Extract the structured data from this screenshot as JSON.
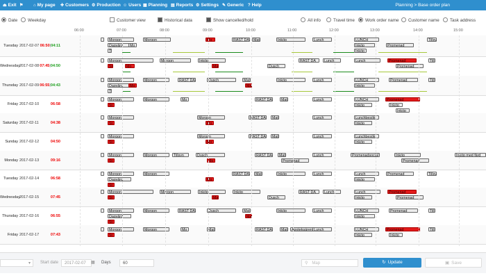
{
  "menu": [
    {
      "label": "Exit",
      "icon": "exit-icon",
      "glyph": "⏏"
    },
    {
      "label": "",
      "icon": "flag-icon",
      "glyph": "⚑"
    },
    {
      "label": "My page",
      "icon": "home-icon",
      "glyph": "⌂"
    },
    {
      "label": "Customers",
      "icon": "customers-icon",
      "glyph": "✚"
    },
    {
      "label": "Production",
      "icon": "production-icon",
      "glyph": "⚙"
    },
    {
      "label": "Users",
      "icon": "users-icon",
      "glyph": "☺"
    },
    {
      "label": "Planning",
      "icon": "planning-icon",
      "glyph": "▦"
    },
    {
      "label": "Reports",
      "icon": "reports-icon",
      "glyph": "▤"
    },
    {
      "label": "Settings",
      "icon": "settings-icon",
      "glyph": "⚙"
    },
    {
      "label": "Generic",
      "icon": "generic-icon",
      "glyph": "✎"
    },
    {
      "label": "Help",
      "icon": "help-icon",
      "glyph": "?"
    }
  ],
  "breadcrumb": "Planning > Base order plan",
  "options": {
    "date": "Date",
    "weekday": "Weekday",
    "customer_view": "Customer view",
    "historical": "Historical data",
    "show_cancelled": "Show cancelled/hold",
    "all_info": "All info",
    "travel_time": "Travel time",
    "work_order_name": "Work order name",
    "customer_name": "Customer name",
    "task_address": "Task address"
  },
  "time_ticks": [
    "06:00",
    "07:00",
    "08:00",
    "09:00",
    "10:00",
    "11:00",
    "12:00",
    "13:00",
    "14:00",
    "15:00"
  ],
  "rows": [
    {
      "day": "Tuesday",
      "date": "2017-02-07",
      "t1": "06:50",
      "t2": "04:11",
      "events": [
        [
          "Morgon",
          155,
          38,
          0
        ],
        [
          "Dagvård",
          155,
          34,
          1
        ],
        [
          "Mo",
          185,
          12,
          1
        ],
        [
          "T",
          155,
          6,
          2
        ],
        [
          "Morgon",
          206,
          40,
          0
        ],
        [
          "Mo",
          296,
          14,
          0,
          true
        ],
        [
          "RAST DA",
          334,
          26,
          0
        ],
        [
          "Mat",
          363,
          12,
          0
        ],
        [
          "Inköp",
          398,
          42,
          0
        ],
        [
          "Lunch",
          450,
          28,
          0
        ],
        [
          "LUNCH",
          510,
          36,
          0
        ],
        [
          "Inköp",
          510,
          30,
          1
        ],
        [
          "Inköp",
          510,
          18,
          2
        ],
        [
          "Promenad",
          556,
          40,
          1
        ],
        [
          "Tillsyn",
          615,
          14,
          0
        ]
      ]
    },
    {
      "day": "Wednesday",
      "date": "2017-02-08",
      "t1": "07:45",
      "t2": "04:50",
      "events": [
        [
          "Morgon",
          155,
          66,
          0
        ],
        [
          "Morgon",
          230,
          45,
          0
        ],
        [
          "Inköp",
          285,
          40,
          0
        ],
        [
          "Dusch",
          385,
          26,
          1
        ],
        [
          "RAST DA",
          430,
          30,
          0
        ],
        [
          "Lunch",
          465,
          26,
          0
        ],
        [
          "Mat",
          305,
          10,
          1,
          true
        ],
        [
          "Mo",
          180,
          14,
          1,
          true
        ],
        [
          "St",
          155,
          8,
          1,
          true
        ],
        [
          "Lunch",
          510,
          38,
          0
        ],
        [
          "Promenad",
          558,
          42,
          0,
          true
        ],
        [
          "Promenad",
          570,
          40,
          1
        ],
        [
          "Tills",
          617,
          10,
          0
        ]
      ]
    },
    {
      "day": "Thursday",
      "date": "2017-02-09",
      "t1": "06:55",
      "t2": "04:43",
      "events": [
        [
          "Morgon",
          155,
          38,
          0
        ],
        [
          "Dagvård",
          155,
          34,
          1
        ],
        [
          "Mo",
          185,
          12,
          1,
          true
        ],
        [
          "T",
          155,
          6,
          2
        ],
        [
          "Morgon",
          206,
          38,
          0
        ],
        [
          "RAST DA",
          256,
          26,
          0
        ],
        [
          "Dusch",
          298,
          42,
          0
        ],
        [
          "Mat",
          349,
          12,
          0
        ],
        [
          "Mat",
          353,
          10,
          1,
          true
        ],
        [
          "Inköp",
          398,
          42,
          0
        ],
        [
          "Lunch",
          450,
          28,
          0
        ],
        [
          "LUNCH",
          510,
          36,
          0
        ],
        [
          "Inköp",
          510,
          30,
          1
        ],
        [
          "Promenad",
          560,
          42,
          0
        ],
        [
          "Tills",
          617,
          10,
          0
        ]
      ]
    },
    {
      "day": "Friday",
      "date": "2017-02-10",
      "t1": "06:58",
      "t2": "",
      "events": [
        [
          "Morgon",
          155,
          38,
          0
        ],
        [
          "St",
          155,
          10,
          1,
          true
        ],
        [
          "Morgon",
          206,
          38,
          0
        ],
        [
          "Mo",
          260,
          12,
          0
        ],
        [
          "RAST DA",
          367,
          26,
          0
        ],
        [
          "Mat",
          403,
          12,
          0
        ],
        [
          "Lunch",
          450,
          28,
          0
        ],
        [
          "LUNCH",
          510,
          36,
          0
        ],
        [
          "Inköp",
          510,
          26,
          1
        ],
        [
          "Promenad",
          555,
          50,
          0,
          true
        ],
        [
          "Inköp",
          560,
          20,
          1
        ],
        [
          "Inköp",
          570,
          20,
          2
        ]
      ]
    },
    {
      "day": "Saturday",
      "date": "2017-02-11",
      "t1": "04:38",
      "t2": "",
      "events": [
        [
          "Morgon",
          155,
          38,
          0
        ],
        [
          "St",
          155,
          10,
          1,
          true
        ],
        [
          "Morgon",
          284,
          40,
          0
        ],
        [
          "Mo",
          296,
          12,
          1,
          true
        ],
        [
          "RAST DA",
          358,
          26,
          0
        ],
        [
          "Mat",
          390,
          12,
          0
        ],
        [
          "Lunch",
          450,
          28,
          0
        ],
        [
          "Lunchbesök",
          510,
          36,
          0
        ],
        [
          "Inköp",
          510,
          26,
          1
        ]
      ]
    },
    {
      "day": "Sunday",
      "date": "2017-02-12",
      "t1": "04:50",
      "t2": "",
      "events": [
        [
          "Morgon",
          155,
          38,
          0
        ],
        [
          "St",
          155,
          10,
          1,
          true
        ],
        [
          "Morgon",
          284,
          40,
          0
        ],
        [
          "Mo",
          296,
          12,
          1,
          true
        ],
        [
          "RAST DA",
          358,
          26,
          0
        ],
        [
          "Mat",
          390,
          12,
          0
        ],
        [
          "Lunch",
          450,
          28,
          0
        ],
        [
          "Lunchbesök",
          510,
          36,
          0
        ],
        [
          "Inköp",
          510,
          26,
          1
        ]
      ]
    },
    {
      "day": "Monday",
      "date": "2017-02-13",
      "t1": "09:16",
      "t2": "",
      "events": [
        [
          "Morgon",
          155,
          38,
          0
        ],
        [
          "St",
          155,
          10,
          1,
          true
        ],
        [
          "Morgon",
          206,
          38,
          0
        ],
        [
          "Tillsyn",
          248,
          24,
          0
        ],
        [
          "Dusch",
          282,
          42,
          0
        ],
        [
          "Mo",
          298,
          12,
          1,
          true
        ],
        [
          "RAST DA",
          367,
          26,
          0
        ],
        [
          "Mat",
          400,
          12,
          0
        ],
        [
          "Promenad",
          405,
          40,
          1
        ],
        [
          "Lunch",
          450,
          28,
          0
        ],
        [
          "Promenadsocial",
          505,
          42,
          0
        ],
        [
          "Inköp",
          568,
          38,
          0
        ],
        [
          "Promenad",
          578,
          40,
          1
        ],
        [
          "Inköp med färd",
          655,
          45,
          0
        ]
      ]
    },
    {
      "day": "Tuesday",
      "date": "2017-02-14",
      "t1": "06:58",
      "t2": "",
      "events": [
        [
          "Morgon",
          155,
          38,
          0
        ],
        [
          "Dagvård",
          155,
          34,
          1
        ],
        [
          "St",
          155,
          10,
          2,
          true
        ],
        [
          "Morgon",
          206,
          38,
          0
        ],
        [
          "Mo",
          296,
          12,
          1,
          true
        ],
        [
          "RAST DA",
          334,
          26,
          0
        ],
        [
          "Mat",
          366,
          12,
          0
        ],
        [
          "Inköp",
          398,
          42,
          0
        ],
        [
          "Lunch",
          450,
          28,
          0
        ],
        [
          "Lunch",
          510,
          36,
          0
        ],
        [
          "Inköp",
          510,
          30,
          1
        ],
        [
          "Promenad",
          556,
          40,
          0
        ],
        [
          "Tillsyn",
          615,
          14,
          0
        ]
      ]
    },
    {
      "day": "Wednesday",
      "date": "2017-02-15",
      "t1": "07:45",
      "t2": "",
      "events": [
        [
          "Morgon",
          155,
          66,
          0
        ],
        [
          "St",
          155,
          10,
          1,
          true
        ],
        [
          "Morgon",
          230,
          45,
          0
        ],
        [
          "Inköp",
          285,
          40,
          0
        ],
        [
          "Mat",
          305,
          10,
          1,
          true
        ],
        [
          "Inköp",
          335,
          40,
          0
        ],
        [
          "Dusch",
          385,
          26,
          1
        ],
        [
          "RAST DA",
          430,
          30,
          0
        ],
        [
          "Lunch",
          465,
          26,
          0
        ],
        [
          "Lunch",
          510,
          38,
          0
        ],
        [
          "Inköp",
          510,
          26,
          1
        ],
        [
          "Promenad",
          558,
          42,
          0,
          true
        ],
        [
          "Promenad",
          570,
          40,
          1
        ]
      ]
    },
    {
      "day": "Thursday",
      "date": "2017-02-16",
      "t1": "06:55",
      "t2": "",
      "events": [
        [
          "Morgon",
          155,
          38,
          0
        ],
        [
          "Dagvård",
          155,
          34,
          1
        ],
        [
          "St",
          155,
          10,
          2,
          true
        ],
        [
          "Morgon",
          206,
          38,
          0
        ],
        [
          "RAST DA",
          256,
          26,
          0
        ],
        [
          "Dusch",
          298,
          42,
          0
        ],
        [
          "Mat",
          349,
          12,
          0
        ],
        [
          "Mat",
          353,
          10,
          1,
          true
        ],
        [
          "Inköp",
          398,
          42,
          0
        ],
        [
          "Lunch",
          450,
          28,
          0
        ],
        [
          "LUNCH",
          510,
          36,
          0
        ],
        [
          "Inköp",
          510,
          30,
          1
        ],
        [
          "Promenad",
          560,
          42,
          0
        ],
        [
          "Tills",
          617,
          10,
          0
        ]
      ]
    },
    {
      "day": "Friday",
      "date": "2017-02-17",
      "t1": "07:43",
      "t2": "",
      "events": [
        [
          "Morgon",
          155,
          38,
          0
        ],
        [
          "St",
          155,
          10,
          1,
          true
        ],
        [
          "Morgon",
          206,
          38,
          0
        ],
        [
          "Mo",
          260,
          12,
          0
        ],
        [
          "Mat",
          298,
          12,
          0
        ],
        [
          "RAST DA",
          367,
          26,
          0
        ],
        [
          "Mat",
          403,
          12,
          0
        ],
        [
          "Apoteksärende",
          418,
          42,
          0
        ],
        [
          "Lunch",
          450,
          28,
          0
        ],
        [
          "LUNCH",
          510,
          36,
          0
        ],
        [
          "Inköp",
          510,
          26,
          1
        ],
        [
          "Promenad",
          555,
          50,
          0,
          true
        ],
        [
          "Inköp",
          560,
          20,
          1
        ],
        [
          "Tills",
          617,
          10,
          0
        ]
      ]
    },
    {
      "day": "",
      "date": "",
      "t1": "",
      "t2": "",
      "events": [
        [
          "",
          148,
          6,
          0
        ],
        [
          "",
          155,
          38,
          0
        ],
        [
          "",
          206,
          38,
          0
        ],
        [
          "",
          296,
          12,
          0
        ],
        [
          "",
          367,
          26,
          0
        ],
        [
          "",
          510,
          36,
          0
        ]
      ]
    }
  ],
  "bottom": {
    "start_date_label": "Start date",
    "start_date_value": "2017-02-07",
    "days_label": "Days",
    "days_value": "60",
    "map": "Map",
    "update": "Update",
    "save": "Save"
  }
}
